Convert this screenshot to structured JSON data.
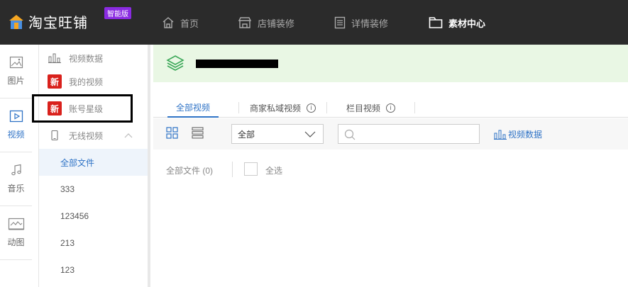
{
  "brand": {
    "name": "淘宝旺铺",
    "edition": "智能版"
  },
  "topnav": [
    {
      "label": "首页",
      "icon": "home-icon"
    },
    {
      "label": "店铺装修",
      "icon": "store-icon"
    },
    {
      "label": "详情装修",
      "icon": "document-icon"
    },
    {
      "label": "素材中心",
      "icon": "folder-icon",
      "active": true
    }
  ],
  "rail": [
    {
      "label": "图片",
      "icon": "image-icon"
    },
    {
      "label": "视频",
      "icon": "video-icon",
      "active": true
    },
    {
      "label": "音乐",
      "icon": "music-icon"
    },
    {
      "label": "动图",
      "icon": "gif-icon"
    }
  ],
  "side": {
    "video_data": "视频数据",
    "my_videos": "我的视频",
    "account_level": "账号星级",
    "wireless_video": "无线视频",
    "new_badge": "新",
    "folders": [
      "全部文件",
      "333",
      "123456",
      "213",
      "123"
    ]
  },
  "tabs": [
    {
      "label": "全部视频",
      "active": true
    },
    {
      "label": "商家私域视频",
      "info": "i"
    },
    {
      "label": "栏目视频",
      "info": "i"
    }
  ],
  "toolbar": {
    "filter_value": "全部",
    "search_placeholder": "",
    "video_data_link": "视频数据"
  },
  "filebar": {
    "count_label": "全部文件 (0)",
    "select_all": "全选"
  },
  "colors": {
    "topbar": "#2b2b2b",
    "accent": "#2f73c6",
    "banner": "#e9f7e4",
    "new_badge": "#d9211c",
    "edition_badge": "#8a2be2"
  }
}
